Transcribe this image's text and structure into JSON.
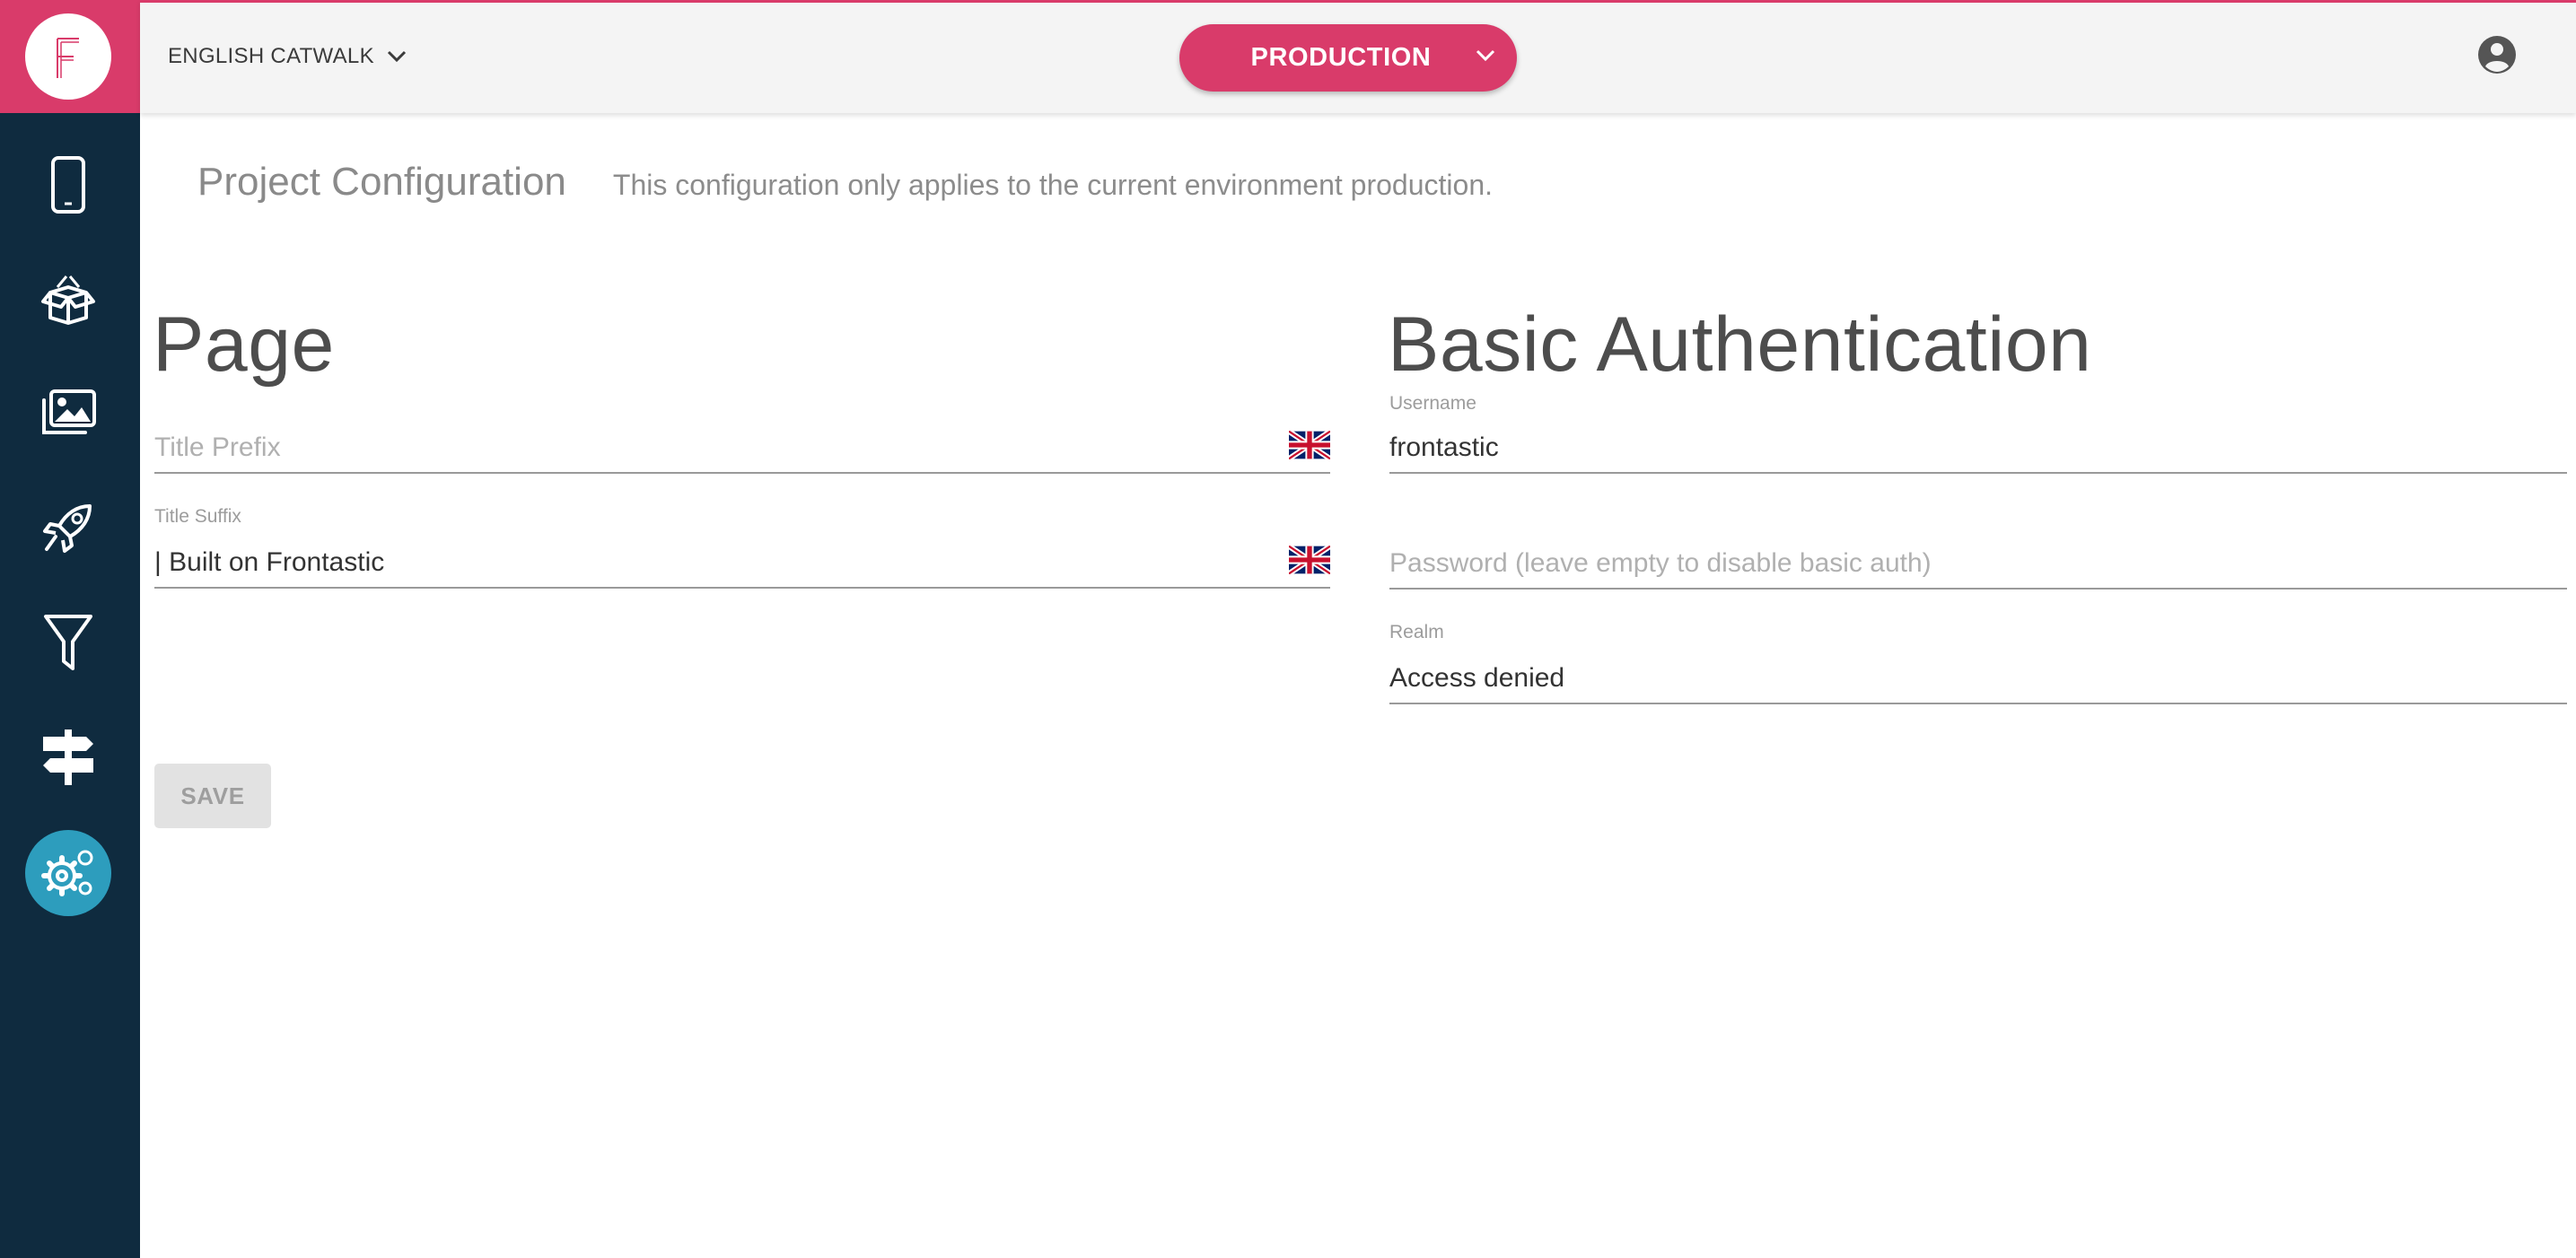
{
  "app": {
    "brand_color": "#d93b6a",
    "sidebar_color": "#0f2b3f",
    "active_color": "#2d9dbd"
  },
  "topbar": {
    "project_name": "ENGLISH CATWALK",
    "environment": "PRODUCTION"
  },
  "sidebar": {
    "items": [
      {
        "icon": "mobile-device-icon"
      },
      {
        "icon": "box-icon"
      },
      {
        "icon": "images-icon"
      },
      {
        "icon": "rocket-icon"
      },
      {
        "icon": "filter-icon"
      },
      {
        "icon": "signpost-icon"
      },
      {
        "icon": "gears-icon",
        "active": true
      }
    ]
  },
  "header": {
    "title": "Project Configuration",
    "description": "This configuration only applies to the current environment production."
  },
  "page_section": {
    "title": "Page",
    "title_prefix_placeholder": "Title Prefix",
    "title_suffix_label": "Title Suffix",
    "title_suffix_value": "| Built on Frontastic",
    "save_label": "SAVE"
  },
  "auth_section": {
    "title": "Basic Authentication",
    "username_label": "Username",
    "username_value": "frontastic",
    "password_placeholder": "Password (leave empty to disable basic auth)",
    "realm_label": "Realm",
    "realm_value": "Access denied"
  }
}
